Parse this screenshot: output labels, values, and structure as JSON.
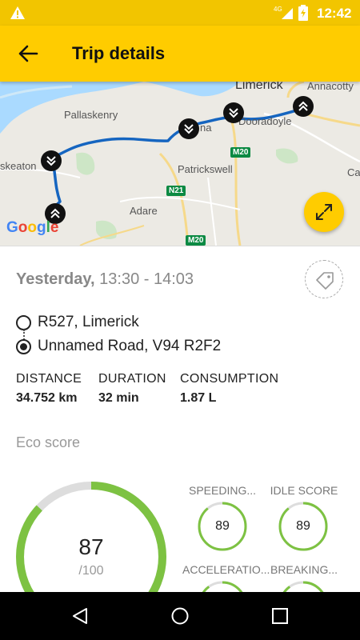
{
  "status_bar": {
    "time": "12:42",
    "network": "4G"
  },
  "toolbar": {
    "title": "Trip details"
  },
  "map": {
    "labels": {
      "limerick": "Limerick",
      "annacotty": "Annacotty",
      "pallaskenry": "Pallaskenry",
      "dooradoyle": "Dooradoyle",
      "na": "na",
      "askeaton": "skeaton",
      "patrickswell": "Patrickswell",
      "adare": "Adare",
      "ca": "Ca"
    },
    "roads": {
      "m20_top": "M20",
      "n21": "N21",
      "m20_bottom": "M20"
    },
    "attribution": "Google",
    "route_color": "#1565c0"
  },
  "trip": {
    "day": "Yesterday,",
    "time_range": " 13:30 - 14:03",
    "start": "R527, Limerick",
    "end": "Unnamed Road, V94 R2F2"
  },
  "stats": {
    "distance_label": "DISTANCE",
    "distance_value": "34.752 km",
    "duration_label": "DURATION",
    "duration_value": "32 min",
    "consumption_label": "CONSUMPTION",
    "consumption_value": "1.87 L"
  },
  "eco": {
    "title": "Eco score",
    "score": "87",
    "max": "/100",
    "score_fraction": 0.87,
    "color": "#7dc242",
    "track_color": "#dddddd",
    "sub_scores": [
      {
        "label": "SPEEDING...",
        "value": "89",
        "fraction": 0.89
      },
      {
        "label": "IDLE SCORE",
        "value": "89",
        "fraction": 0.89
      },
      {
        "label": "ACCELERATIO...",
        "value": "",
        "fraction": 0.9
      },
      {
        "label": "BREAKING...",
        "value": "",
        "fraction": 0.9
      }
    ]
  },
  "colors": {
    "accent": "#ffcc00",
    "status": "#f2c500"
  }
}
